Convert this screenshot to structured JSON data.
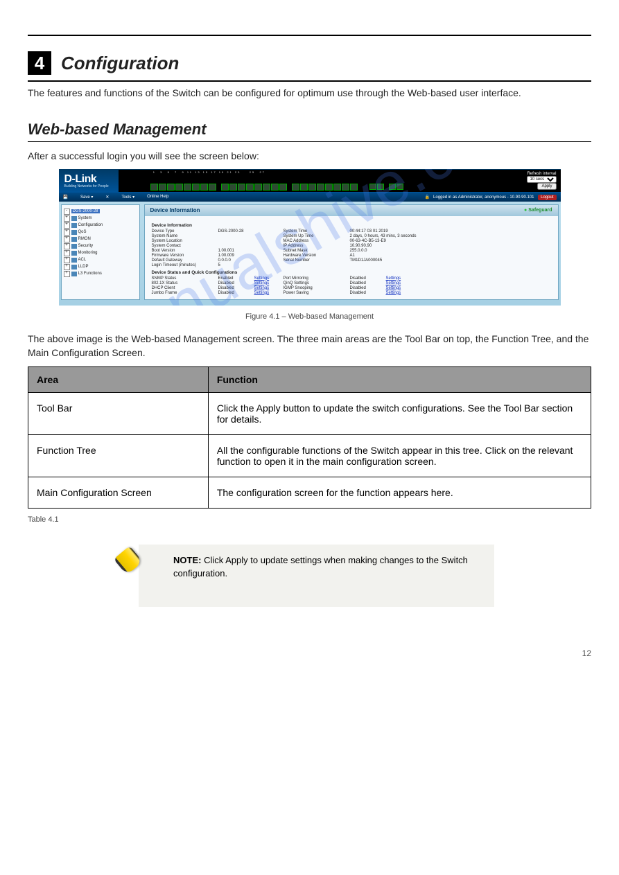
{
  "chapter": {
    "num": "4",
    "title": "Configuration"
  },
  "intro": "The features and functions of the Switch can be configured for optimum use through the Web-based user interface.",
  "section1": {
    "title": "Web-based Management",
    "para": "After a successful login you will see the screen below:",
    "caption": "Figure 4.1 – Web-based Management"
  },
  "areas_intro": "The above image is the Web-based Management screen. The three main areas are the Tool Bar on top, the Function Tree, and the Main Configuration Screen.",
  "table": {
    "headers": [
      "Area",
      "Function"
    ],
    "rows": [
      [
        "Tool Bar",
        "Click the Apply button to update the switch configurations. See the Tool Bar section for details."
      ],
      [
        "Function Tree",
        "All the configurable functions of the Switch appear in this tree. Click on the relevant function to open it in the main configuration screen."
      ],
      [
        "Main Configuration Screen",
        "The configuration screen for the function appears here."
      ]
    ],
    "caption": "Table 4.1"
  },
  "note": {
    "label": "NOTE:",
    "text": " Click Apply to update settings when making changes to the Switch configuration."
  },
  "watermark": "manualshive.com",
  "page_footer": "12",
  "ui": {
    "brand": "D-Link",
    "brand_sub": "Building Networks for People",
    "refresh_label": "Refresh interval",
    "refresh_value": "10 secs",
    "apply_btn": "Apply",
    "menu": {
      "save": "Save",
      "tools": "Tools",
      "help": "Online Help"
    },
    "login_status": "Logged in as Administrator, anonymous - 10.90.90.101",
    "logout": "Logout",
    "tree_root": "DGS-2000-28",
    "tree_items": [
      "System",
      "Configuration",
      "QoS",
      "RMON",
      "Security",
      "Monitoring",
      "ACL",
      "LLDP",
      "L3 Functions"
    ],
    "panel_title": "Device Information",
    "safeguard": "Safeguard",
    "sections": {
      "dev_info_label": "Device Information",
      "dsq_label": "Device Status and Quick Configurations"
    },
    "dev": {
      "rows": [
        [
          "Device Type",
          "DGS-2000-28",
          "System Time",
          "00:44:17 03 01 2019"
        ],
        [
          "System Name",
          "",
          "System Up Time",
          "2 days, 0 hours, 43 mins, 3 seconds"
        ],
        [
          "System Location",
          "",
          "MAC Address",
          "00-63-4C-B5-13-E9"
        ],
        [
          "System Contact",
          "",
          "IP Address",
          "10.90.90.90"
        ],
        [
          "Boot Version",
          "1.00.001",
          "Subnet Mask",
          "255.0.0.0"
        ],
        [
          "Firmware Version",
          "1.00.009",
          "Hardware Version",
          "A1"
        ],
        [
          "Default Gateway",
          "0.0.0.0",
          "Serial Number",
          "TM1D1JA000045"
        ],
        [
          "Login Timeout (minutes)",
          "5",
          "",
          ""
        ]
      ]
    },
    "dsq": {
      "rows": [
        [
          "SNMP Status",
          "Enabled",
          "Port Mirroring",
          "Disabled"
        ],
        [
          "802.1X Status",
          "Disabled",
          "QinQ Settings",
          "Disabled"
        ],
        [
          "DHCP Client",
          "Disabled",
          "IGMP Snooping",
          "Disabled"
        ],
        [
          "Jumbo Frame",
          "Disabled",
          "Power Saving",
          "Disabled"
        ]
      ],
      "settings_label": "Settings"
    }
  }
}
